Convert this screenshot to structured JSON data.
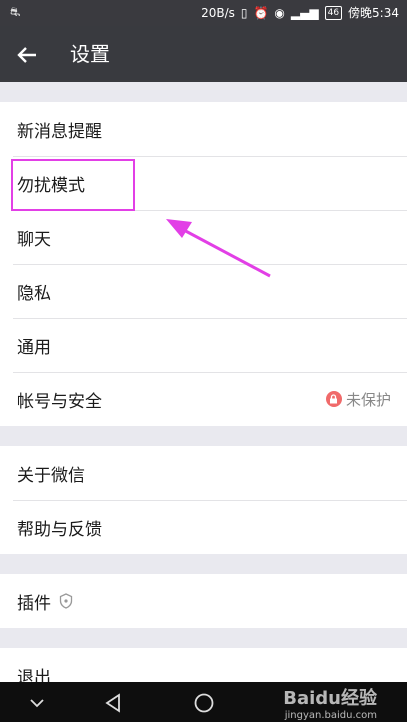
{
  "status_bar": {
    "network_speed": "20B/s",
    "battery": "46",
    "time": "傍晚5:34"
  },
  "header": {
    "title": "设置"
  },
  "groups": [
    {
      "items": [
        {
          "label": "新消息提醒"
        },
        {
          "label": "勿扰模式"
        },
        {
          "label": "聊天"
        },
        {
          "label": "隐私"
        },
        {
          "label": "通用"
        },
        {
          "label": "帐号与安全",
          "status": "未保护"
        }
      ]
    },
    {
      "items": [
        {
          "label": "关于微信"
        },
        {
          "label": "帮助与反馈"
        }
      ]
    },
    {
      "items": [
        {
          "label": "插件"
        }
      ]
    },
    {
      "items": [
        {
          "label": "退出"
        }
      ]
    }
  ],
  "watermark": {
    "brand": "Baidu经验",
    "url": "jingyan.baidu.com"
  },
  "colors": {
    "appbar": "#393a3f",
    "highlight": "#e23fe6",
    "lock_badge": "#f06a6a"
  }
}
